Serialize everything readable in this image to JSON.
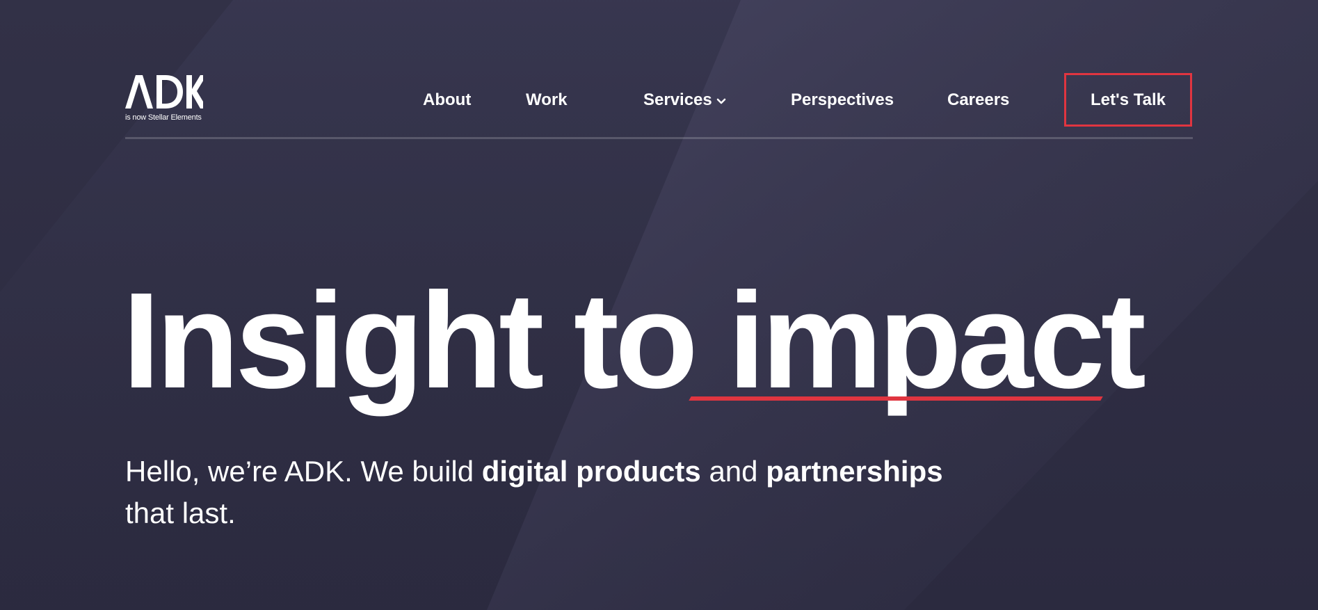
{
  "brand": {
    "wordmark": "ADK",
    "tagline": "is now Stellar Elements"
  },
  "nav": {
    "about": "About",
    "work": "Work",
    "services": "Services",
    "perspectives": "Perspectives",
    "careers": "Careers",
    "cta": "Let's Talk"
  },
  "hero": {
    "headline_part1": "Insight to ",
    "headline_emphasis": "impact",
    "intro": {
      "t1": "Hello, we’re ADK. We build ",
      "b1": "digital products",
      "t2": " and ",
      "b2": "partnerships",
      "t3": " that last."
    }
  },
  "colors": {
    "background": "#2e2d42",
    "accent": "#e03540",
    "text": "#ffffff"
  },
  "icons": {
    "services_dropdown": "chevron-down-icon"
  }
}
